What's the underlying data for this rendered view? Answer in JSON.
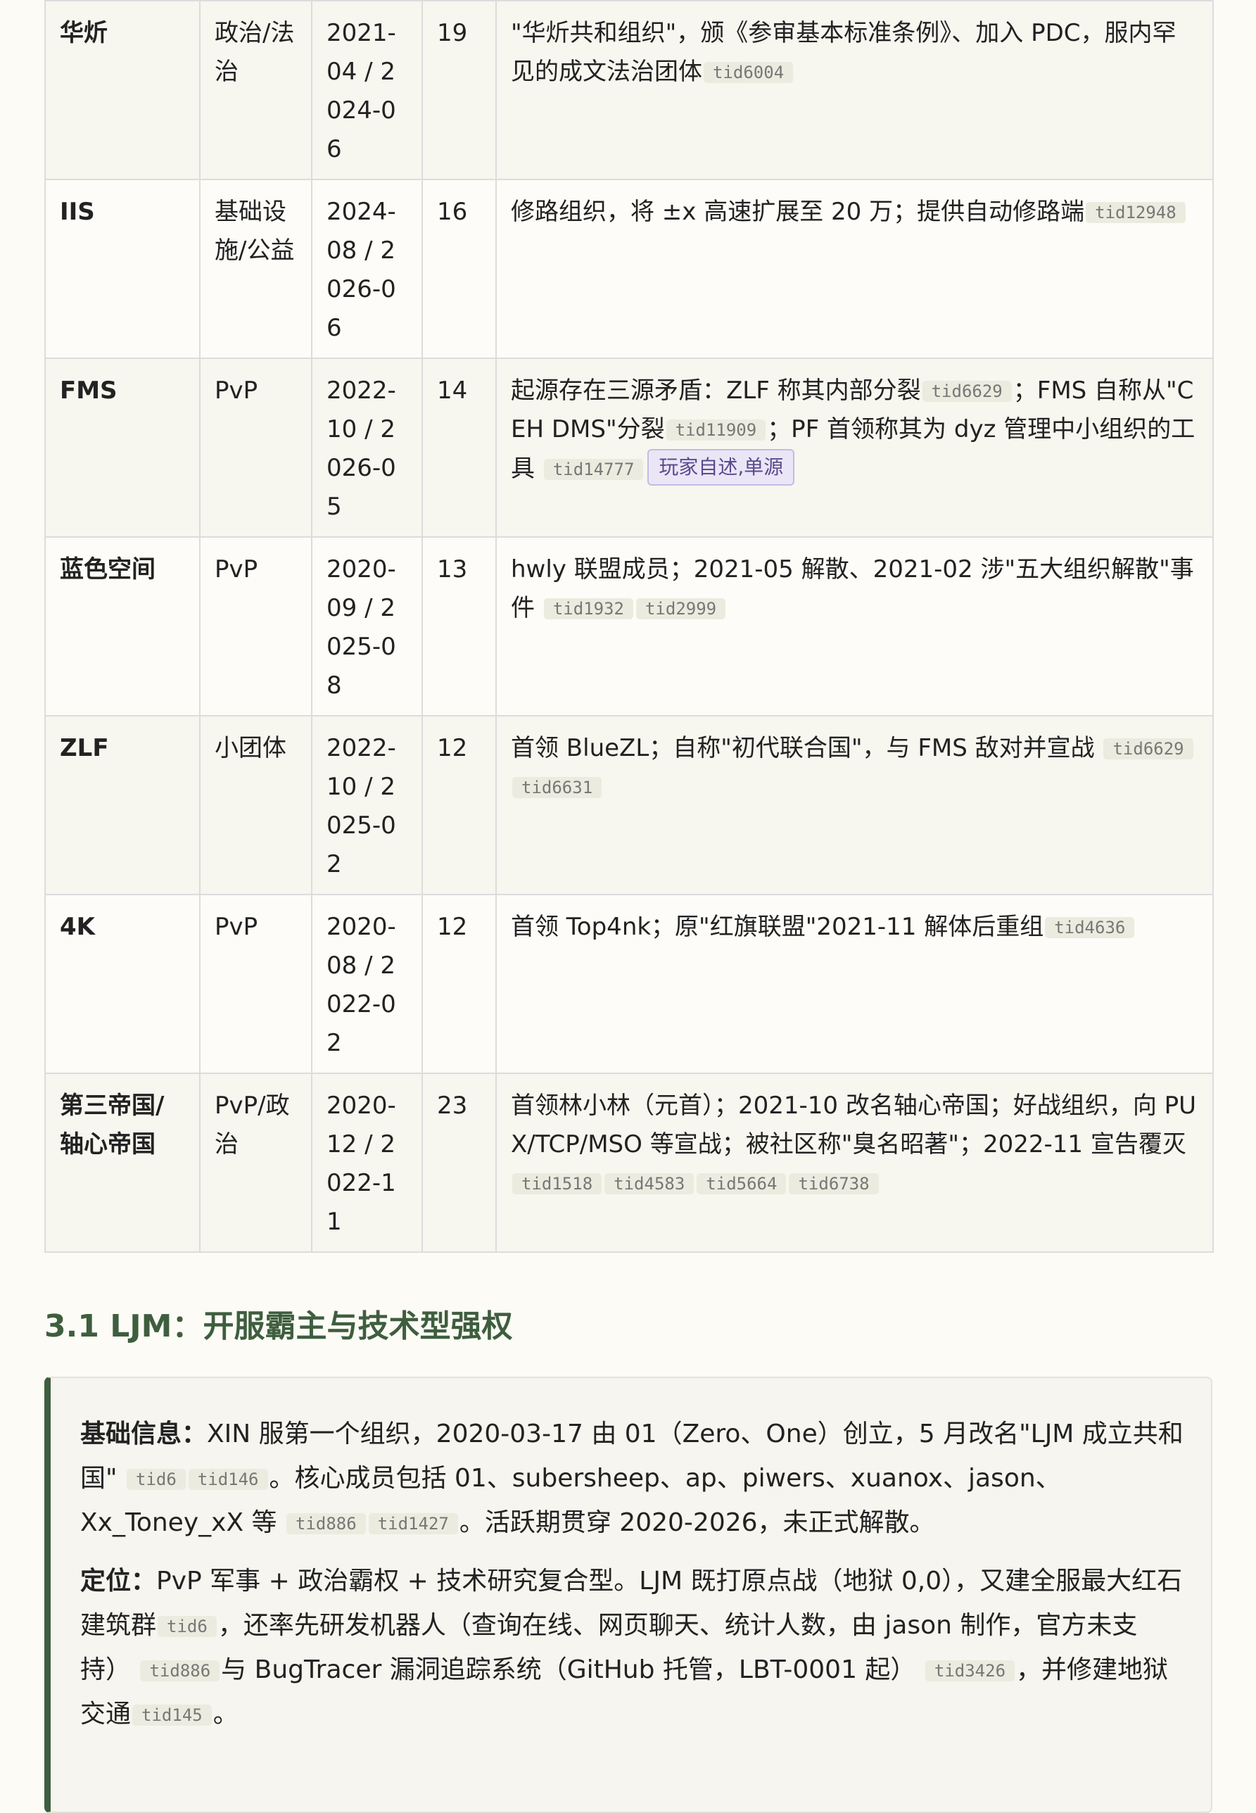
{
  "rows": [
    {
      "name": "华炘",
      "category": "政治/法治",
      "period": "2021-04 / 2024-06",
      "count": "19",
      "desc": "\"华炘共和组织\"，颁《参审基本标准条例》、加入 PDC，服内罕见的成文法治团体",
      "tids": [
        "tid6004"
      ]
    },
    {
      "name": "IIS",
      "category": "基础设施/公益",
      "period": "2024-08 / 2026-06",
      "count": "16",
      "desc": "修路组织，将 ±x 高速扩展至 20 万；提供自动修路端",
      "tids": [
        "tid12948"
      ]
    },
    {
      "name": "FMS",
      "category": "PvP",
      "period": "2022-10 / 2026-05",
      "count": "14",
      "desc_a": "起源存在三源矛盾：ZLF 称其内部分裂",
      "tid_a": "tid6629",
      "desc_b": "；FMS 自称从\"CEH DMS\"分裂",
      "tid_b": "tid11909",
      "desc_c": "；PF 首领称其为 dyz 管理中小组织的工具",
      "tid_c": "tid14777",
      "note": "玩家自述,单源"
    },
    {
      "name": "蓝色空间",
      "category": "PvP",
      "period": "2020-09 / 2025-08",
      "count": "13",
      "desc": "hwly 联盟成员；2021-05 解散、2021-02 涉\"五大组织解散\"事件",
      "tids": [
        "tid1932",
        "tid2999"
      ]
    },
    {
      "name": "ZLF",
      "category": "小团体",
      "period": "2022-10 / 2025-02",
      "count": "12",
      "desc": "首领 BlueZL；自称\"初代联合国\"，与 FMS 敌对并宣战",
      "tids": [
        "tid6629",
        "tid6631"
      ]
    },
    {
      "name": "4K",
      "category": "PvP",
      "period": "2020-08 / 2022-02",
      "count": "12",
      "desc": "首领 Top4nk；原\"红旗联盟\"2021-11 解体后重组",
      "tids": [
        "tid4636"
      ]
    },
    {
      "name": "第三帝国/轴心帝国",
      "category": "PvP/政治",
      "period": "2020-12 / 2022-11",
      "count": "23",
      "desc": "首领林小林（元首）；2021-10 改名轴心帝国；好战组织，向 PUX/TCP/MSO 等宣战；被社区称\"臭名昭著\"；2022-11 宣告覆灭",
      "tids": [
        "tid1518",
        "tid4583",
        "tid5664",
        "tid6738"
      ]
    }
  ],
  "section": {
    "title": "3.1 LJM：开服霸主与技术型强权",
    "p1": {
      "label": "基础信息：",
      "t1": "XIN 服第一个组织，2020-03-17 由 01（Zero、One）创立，5 月改名\"LJM 成立共和国\"",
      "tid1": "tid6",
      "tid2": "tid146",
      "t2": "。核心成员包括 01、subersheep、ap、piwers、xuanox、jason、Xx_Toney_xX 等",
      "tid3": "tid886",
      "tid4": "tid1427",
      "t3": "。活跃期贯穿 2020-2026，未正式解散。"
    },
    "p2": {
      "label": "定位：",
      "t1": "PvP 军事 + 政治霸权 + 技术研究复合型。LJM 既打原点战（地狱 0,0），又建全服最大红石建筑群",
      "tid1": "tid6",
      "t2": "，还率先研发机器人（查询在线、网页聊天、统计人数，由 jason 制作，官方未支持）",
      "tid2": "tid886",
      "t3": "与 BugTracer 漏洞追踪系统（GitHub 托管，LBT-0001 起）",
      "tid3": "tid3426",
      "t4": "，并修建地狱交通",
      "tid4": "tid145",
      "t5": "。"
    }
  }
}
